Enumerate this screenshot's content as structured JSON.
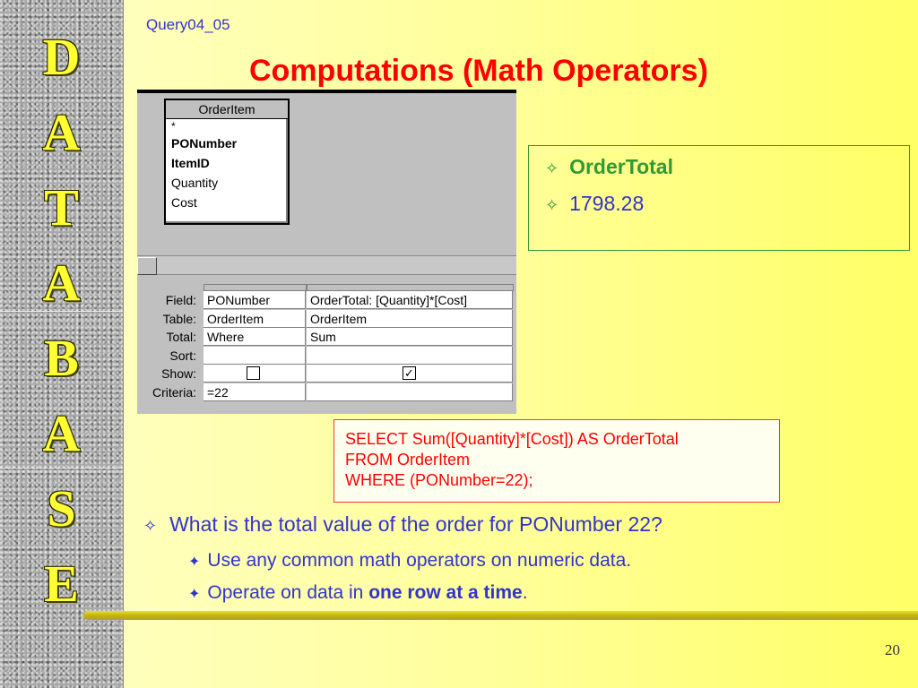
{
  "side_letters": [
    "D",
    "A",
    "T",
    "A",
    "B",
    "A",
    "S",
    "E"
  ],
  "header": {
    "query_ref": "Query04_05",
    "title": "Computations (Math Operators)"
  },
  "access_design": {
    "table": {
      "name": "OrderItem",
      "fields": [
        "*",
        "PONumber",
        "ItemID",
        "Quantity",
        "Cost"
      ]
    },
    "grid": {
      "row_labels": [
        "Field:",
        "Table:",
        "Total:",
        "Sort:",
        "Show:",
        "Criteria:"
      ],
      "columns": [
        {
          "field": "PONumber",
          "table": "OrderItem",
          "total": "Where",
          "sort": "",
          "show": "",
          "criteria": "=22"
        },
        {
          "field": "OrderTotal: [Quantity]*[Cost]",
          "table": "OrderItem",
          "total": "Sum",
          "sort": "",
          "show": "✓",
          "criteria": ""
        }
      ]
    }
  },
  "result": {
    "heading": "OrderTotal",
    "value": "1798.28",
    "bullet": "✧"
  },
  "sql": {
    "line1": "SELECT Sum([Quantity]*[Cost]) AS OrderTotal",
    "line2": "FROM OrderItem",
    "line3": "WHERE (PONumber=22);"
  },
  "bullets": {
    "main": "What is the total value of the order for PONumber 22?",
    "sub1": "Use any common math operators on numeric data.",
    "sub2_prefix": "Operate on data in ",
    "sub2_bold": "one row at a time",
    "sub2_suffix": ".",
    "main_bullet": "✧",
    "sub_bullet": "✦"
  },
  "page_number": "20",
  "colors": {
    "title": "#ff0000",
    "accent_blue": "#3333cc",
    "accent_green": "#339933",
    "letters": "#ffff33"
  }
}
